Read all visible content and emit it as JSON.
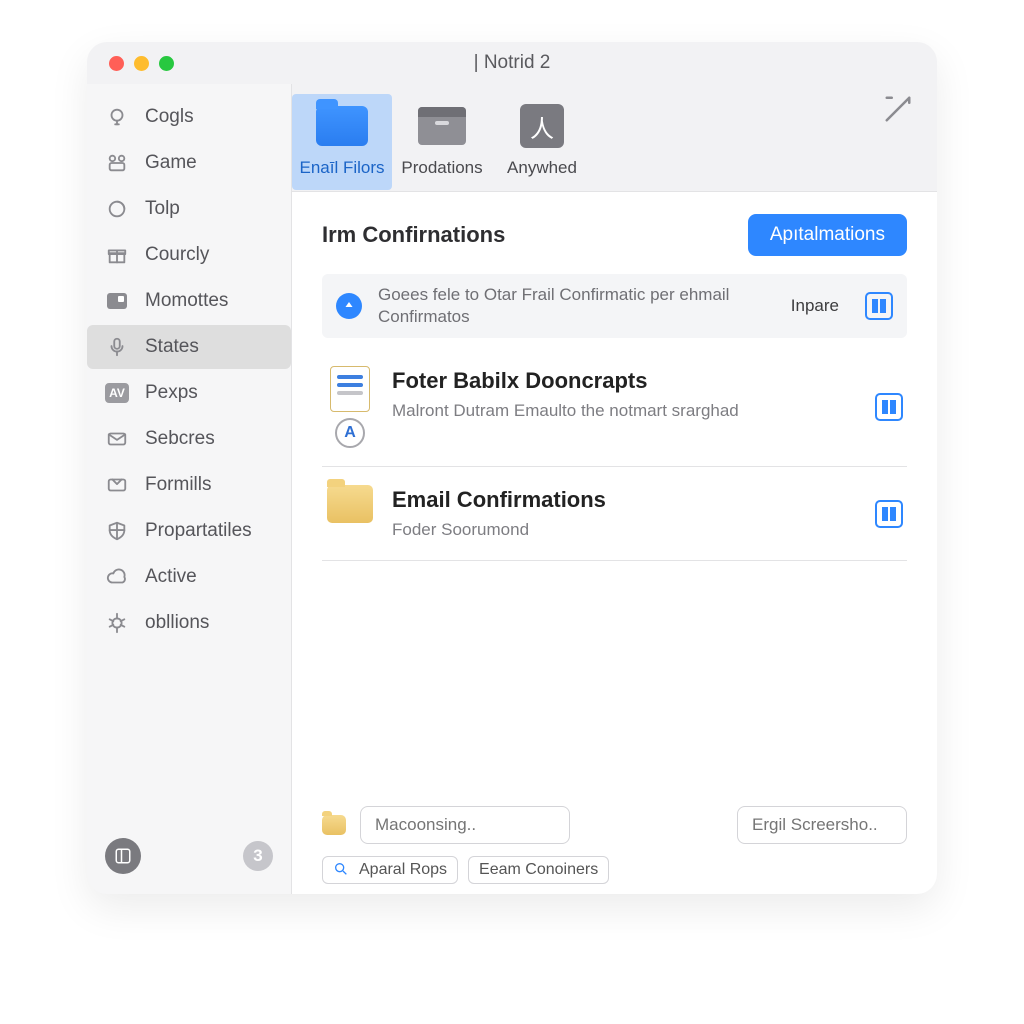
{
  "window": {
    "title": "| Notrid 2"
  },
  "sidebar": {
    "items": [
      {
        "label": "Cogls",
        "icon": "bulb"
      },
      {
        "label": "Game",
        "icon": "game"
      },
      {
        "label": "Tolp",
        "icon": "refresh"
      },
      {
        "label": "Courcly",
        "icon": "gift"
      },
      {
        "label": "Momottes",
        "icon": "square"
      },
      {
        "label": "States",
        "icon": "mic",
        "selected": true
      },
      {
        "label": "Pexps",
        "icon": "av"
      },
      {
        "label": "Sebcres",
        "icon": "mail"
      },
      {
        "label": "Formills",
        "icon": "inbox"
      },
      {
        "label": "Propartatiles",
        "icon": "shield"
      },
      {
        "label": "Active",
        "icon": "cloud"
      },
      {
        "label": "obllions",
        "icon": "bug"
      }
    ],
    "footer_badge": "3"
  },
  "toolbar": {
    "items": [
      {
        "label": "Enaīl Filors",
        "icon": "folder_blue",
        "selected": true
      },
      {
        "label": "Prodations",
        "icon": "box"
      },
      {
        "label": "Anywhed",
        "icon": "pdf"
      }
    ]
  },
  "section": {
    "title": "Irm Confirnations",
    "primary_btn": "Apıtalmations",
    "notice_text": "Goees fele to Otar Frail Confirmatic per ehmail Confirmatos",
    "notice_right": "Inpare"
  },
  "rows": [
    {
      "title": "Foter Babilx Dooncrapts",
      "sub": "Malront Dutram Emaulto the notmart srarghad",
      "icon": "doc_font"
    },
    {
      "title": "Email Confirmations",
      "sub": "Foder Soorumond",
      "icon": "folder"
    }
  ],
  "bottom": {
    "input1_placeholder": "Macoonsing..",
    "input2_placeholder": "Ergil Screersho..",
    "tag1": "Aparal Rops",
    "tag2": "Eeam Conoiners"
  }
}
